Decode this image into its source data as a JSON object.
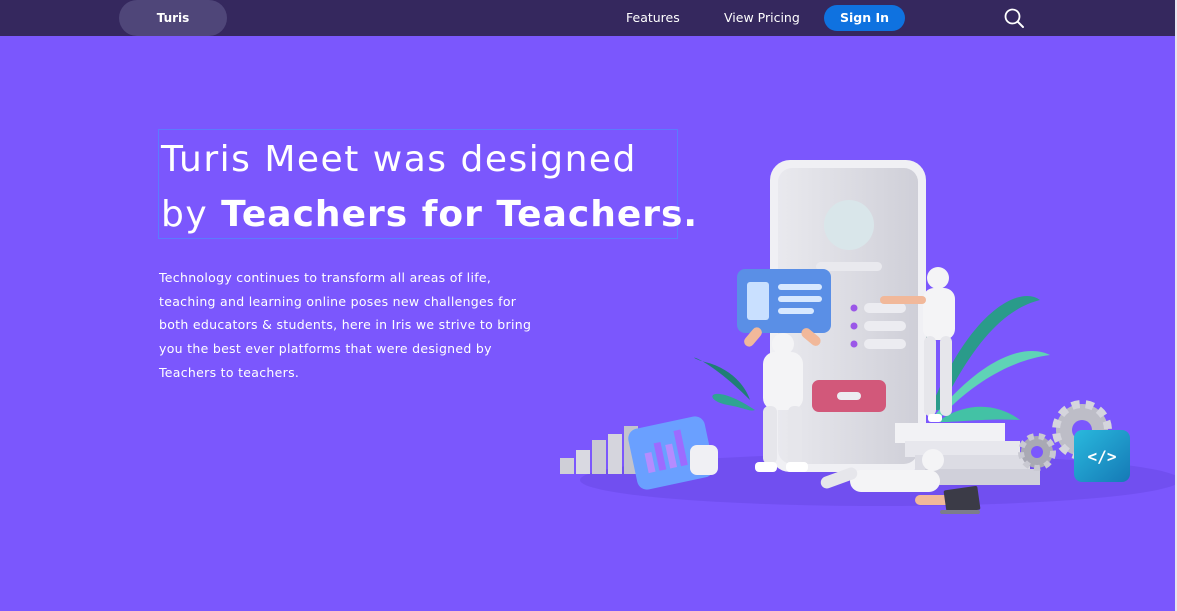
{
  "nav": {
    "brand": "Turis",
    "links": [
      "Features",
      "View Pricing"
    ],
    "signin_label": "Sign In",
    "search_icon": "search-icon"
  },
  "hero": {
    "headline_line1": "Turis Meet was designed",
    "headline_line2_prefix": "by ",
    "headline_line2_bold": "Teachers for Teachers.",
    "description_lines": [
      "Technology continues to transform all areas of life,",
      "teaching and learning online poses new challenges for",
      "both educators & students, here in Iris we strive to bring",
      "you the best ever platforms that were designed by",
      "Teachers to teachers."
    ],
    "code_badge": "</>"
  },
  "colors": {
    "hero_bg": "#7b57fd",
    "navbar_bg": "#35285e",
    "brand_pill": "#4f4679",
    "signin_bg": "#0f72e0",
    "headline_outline": "#5b7bff"
  }
}
